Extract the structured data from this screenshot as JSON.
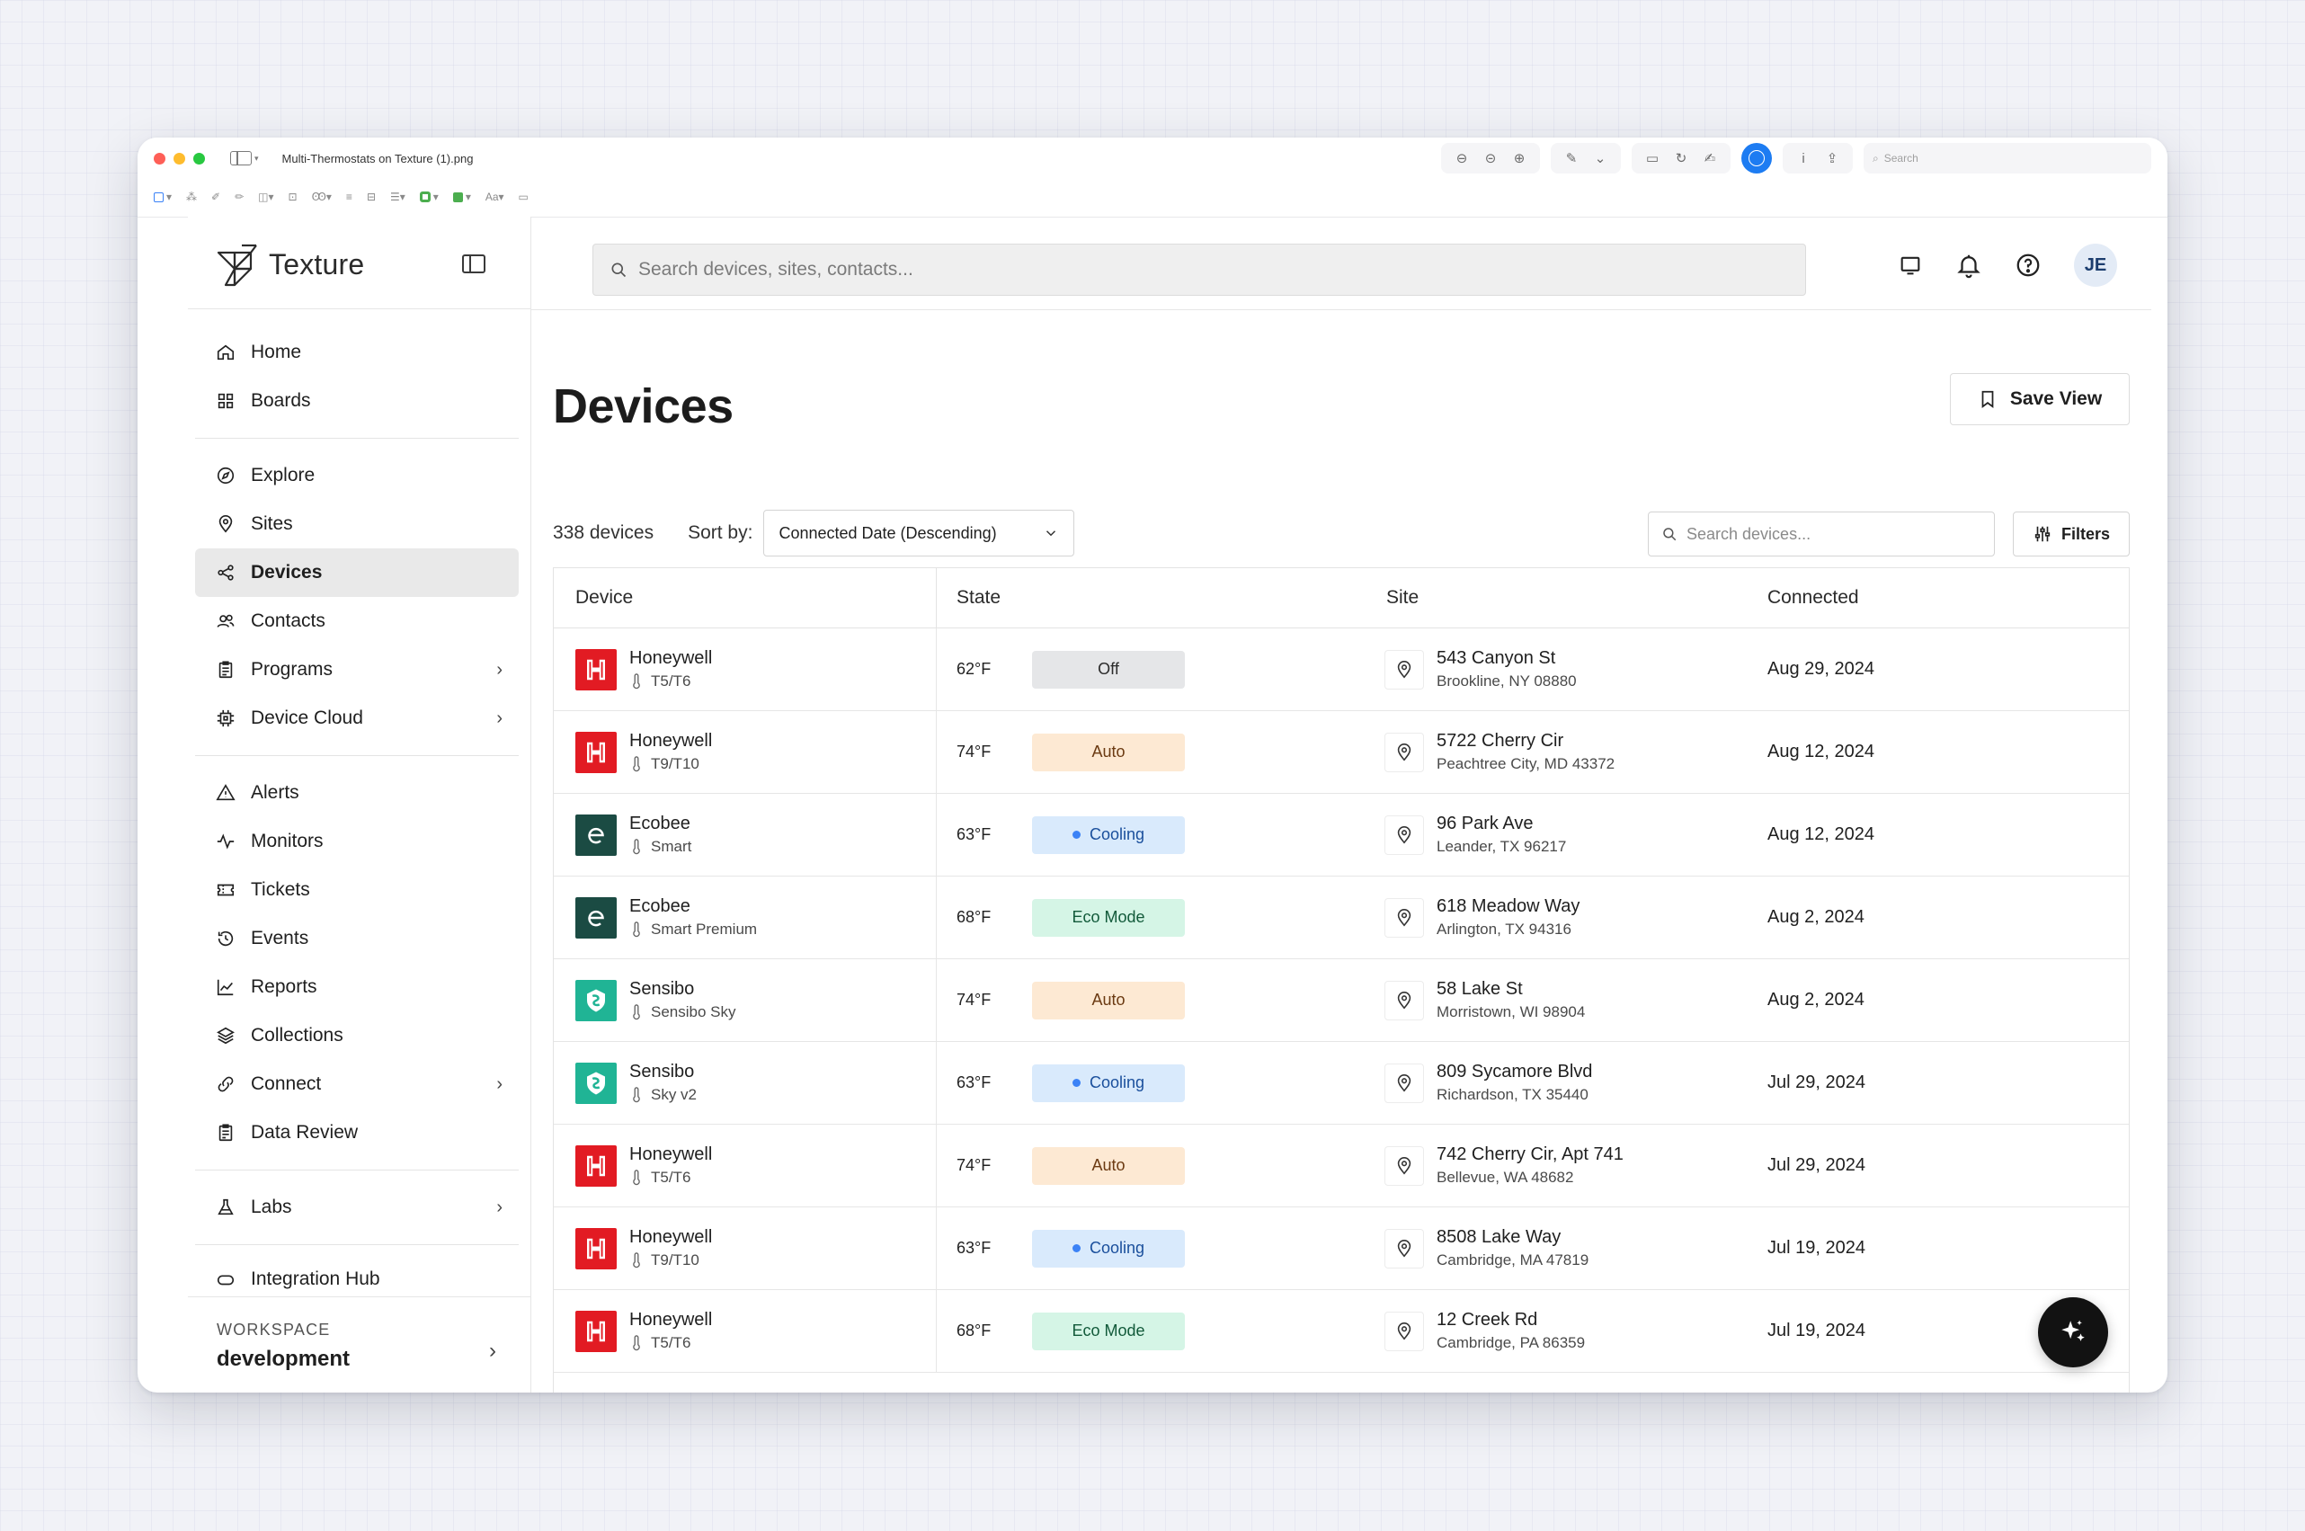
{
  "chrome": {
    "file_title": "Multi-Thermostats on Texture (1).png",
    "search_placeholder": "Search"
  },
  "app": {
    "brand": "Texture",
    "global_search_placeholder": "Search devices, sites, contacts...",
    "avatar_initials": "JE"
  },
  "nav": {
    "items": [
      {
        "label": "Home",
        "icon": "home-icon"
      },
      {
        "label": "Boards",
        "icon": "grid-icon"
      },
      {
        "label": "Explore",
        "icon": "compass-icon"
      },
      {
        "label": "Sites",
        "icon": "map-pin-icon"
      },
      {
        "label": "Devices",
        "icon": "share-nodes-icon"
      },
      {
        "label": "Contacts",
        "icon": "users-icon"
      },
      {
        "label": "Programs",
        "icon": "clipboard-icon"
      },
      {
        "label": "Device Cloud",
        "icon": "chip-icon"
      },
      {
        "label": "Alerts",
        "icon": "alert-triangle-icon"
      },
      {
        "label": "Monitors",
        "icon": "activity-icon"
      },
      {
        "label": "Tickets",
        "icon": "ticket-icon"
      },
      {
        "label": "Events",
        "icon": "history-icon"
      },
      {
        "label": "Reports",
        "icon": "chart-line-icon"
      },
      {
        "label": "Collections",
        "icon": "layers-icon"
      },
      {
        "label": "Connect",
        "icon": "link-icon"
      },
      {
        "label": "Data Review",
        "icon": "clipboard-check-icon"
      },
      {
        "label": "Labs",
        "icon": "flask-icon"
      },
      {
        "label": "Integration Hub",
        "icon": "hub-icon"
      }
    ]
  },
  "workspace": {
    "label": "WORKSPACE",
    "value": "development"
  },
  "page": {
    "title": "Devices",
    "save_view": "Save View",
    "count": "338 devices",
    "sort_label": "Sort by:",
    "sort_value": "Connected Date (Descending)",
    "search_placeholder": "Search devices...",
    "filters": "Filters"
  },
  "table": {
    "headers": [
      "Device",
      "State",
      "Site",
      "Connected"
    ],
    "rows": [
      {
        "brand": "Honeywell",
        "model": "T5/T6",
        "temp": "62°F",
        "state": "Off",
        "addr": "543 Canyon St",
        "city": "Brookline, NY 08880",
        "connected": "Aug 29, 2024"
      },
      {
        "brand": "Honeywell",
        "model": "T9/T10",
        "temp": "74°F",
        "state": "Auto",
        "addr": "5722 Cherry Cir",
        "city": "Peachtree City, MD 43372",
        "connected": "Aug 12, 2024"
      },
      {
        "brand": "Ecobee",
        "model": "Smart",
        "temp": "63°F",
        "state": "Cooling",
        "addr": "96 Park Ave",
        "city": "Leander, TX 96217",
        "connected": "Aug 12, 2024"
      },
      {
        "brand": "Ecobee",
        "model": "Smart Premium",
        "temp": "68°F",
        "state": "Eco Mode",
        "addr": "618 Meadow Way",
        "city": "Arlington, TX 94316",
        "connected": "Aug 2, 2024"
      },
      {
        "brand": "Sensibo",
        "model": "Sensibo Sky",
        "temp": "74°F",
        "state": "Auto",
        "addr": "58 Lake St",
        "city": "Morristown, WI 98904",
        "connected": "Aug 2, 2024"
      },
      {
        "brand": "Sensibo",
        "model": "Sky v2",
        "temp": "63°F",
        "state": "Cooling",
        "addr": "809 Sycamore Blvd",
        "city": "Richardson, TX 35440",
        "connected": "Jul 29, 2024"
      },
      {
        "brand": "Honeywell",
        "model": "T5/T6",
        "temp": "74°F",
        "state": "Auto",
        "addr": "742 Cherry Cir, Apt 741",
        "city": "Bellevue, WA 48682",
        "connected": "Jul 29, 2024"
      },
      {
        "brand": "Honeywell",
        "model": "T9/T10",
        "temp": "63°F",
        "state": "Cooling",
        "addr": "8508 Lake Way",
        "city": "Cambridge, MA 47819",
        "connected": "Jul 19, 2024"
      },
      {
        "brand": "Honeywell",
        "model": "T5/T6",
        "temp": "68°F",
        "state": "Eco Mode",
        "addr": "12 Creek Rd",
        "city": "Cambridge, PA 86359",
        "connected": "Jul 19, 2024"
      }
    ]
  },
  "state_colors": {
    "Off": {
      "bg": "#e5e6e8",
      "fg": "#2b2b2b"
    },
    "Auto": {
      "bg": "#fde9d3",
      "fg": "#6b3a12"
    },
    "Cooling": {
      "bg": "#d9eafc",
      "fg": "#1a4f9c"
    },
    "Eco Mode": {
      "bg": "#d5f5e6",
      "fg": "#125a3a"
    }
  },
  "brand_colors": {
    "Honeywell": "#e21b23",
    "Ecobee": "#1b4b43",
    "Sensibo": "#20b495"
  }
}
